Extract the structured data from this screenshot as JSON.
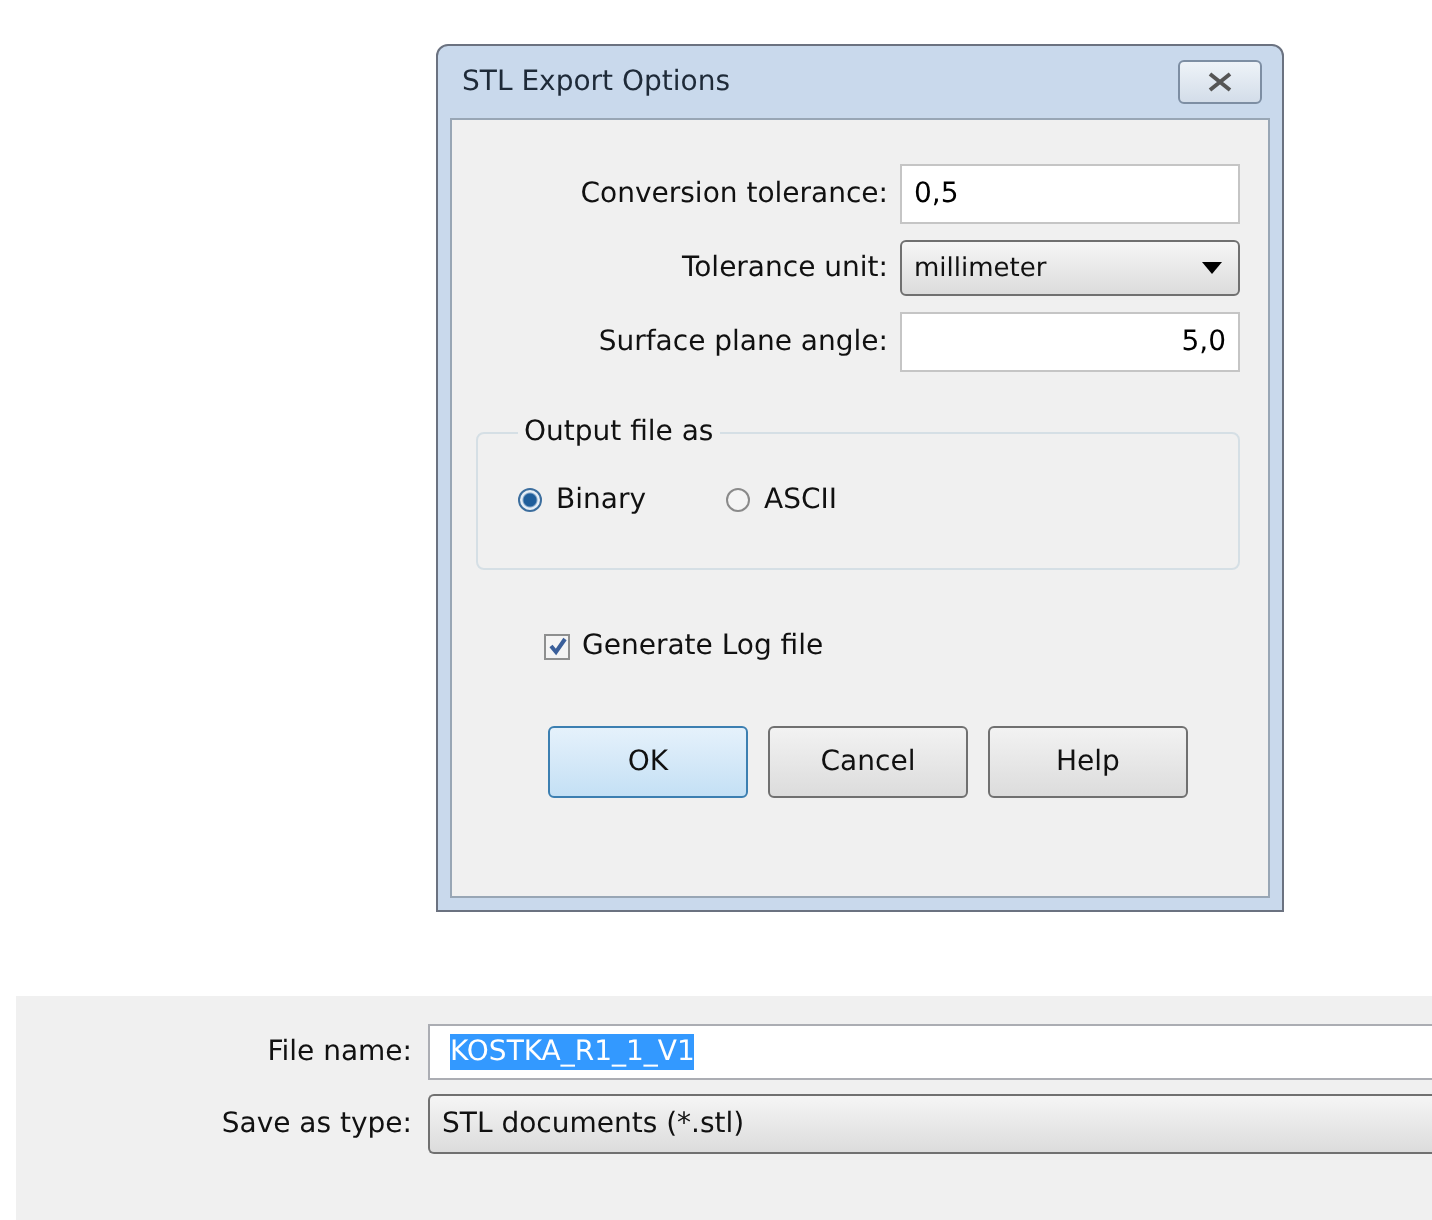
{
  "dialog": {
    "title": "STL Export Options",
    "fields": [
      {
        "kind": "text",
        "label": "Conversion tolerance:",
        "value": "0,5"
      },
      {
        "kind": "dropdown",
        "label": "Tolerance unit:",
        "value": "millimeter"
      },
      {
        "kind": "number",
        "label": "Surface plane angle:",
        "value": "5,0"
      }
    ],
    "output_group": {
      "title": "Output file as",
      "options": [
        {
          "label": "Binary",
          "selected": true
        },
        {
          "label": "ASCII",
          "selected": false
        }
      ]
    },
    "log_checkbox": {
      "label": "Generate Log file",
      "checked": true
    },
    "buttons": [
      {
        "label": "OK",
        "default": true
      },
      {
        "label": "Cancel",
        "default": false
      },
      {
        "label": "Help",
        "default": false
      }
    ]
  },
  "save_form": {
    "file_name": {
      "label": "File name:",
      "value": "KOSTKA_R1_1_V1"
    },
    "save_as_type": {
      "label": "Save as type:",
      "value": "STL documents (*.stl)"
    }
  }
}
